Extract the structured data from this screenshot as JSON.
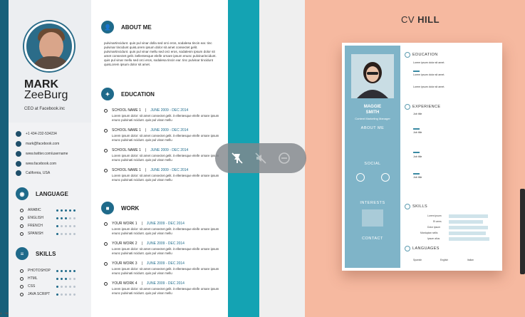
{
  "left_resume": {
    "first_name": "MARK",
    "last_name": "ZeeBurg",
    "role": "CEO at Facebook.inc",
    "contacts": [
      {
        "icon": "phone-icon",
        "text": "+1 434-232-534234"
      },
      {
        "icon": "email-icon",
        "text": "mark@facebook.com"
      },
      {
        "icon": "twitter-icon",
        "text": "www.twitter.com/username"
      },
      {
        "icon": "facebook-icon",
        "text": "www.facebook.com"
      },
      {
        "icon": "location-icon",
        "text": "California, USA"
      }
    ],
    "language_title": "LANGUAGE",
    "languages": [
      {
        "name": "ARABIC",
        "level": 5
      },
      {
        "name": "ENGLISH",
        "level": 3
      },
      {
        "name": "FRENCH",
        "level": 1
      },
      {
        "name": "SPANISH",
        "level": 1
      }
    ],
    "skills_title": "SKILLS",
    "skills": [
      {
        "name": "PHOTOSHOP",
        "level": 5
      },
      {
        "name": "HTML",
        "level": 3
      },
      {
        "name": "CSS",
        "level": 1
      },
      {
        "name": "JAVA SCRIPT",
        "level": 1
      }
    ],
    "about_title": "ABOUT ME",
    "about_text": "pulvinartincidunt. quis pul vinar dolla sed orci eros, sodalesa tincin ear. tinc pulvinar tincidunt quisLorem ipsum dolor sit amet consectet gelit. pulvinartincidunt. quis pul vinar mellu sed orci eros, sodalesm ipsum dolor sit amet consectet gelit. itellentesque eleife ornare ipsum enunc pulvinarincidunt. quis pul vinar mellu sed orci eros, sodalesa tincin ear. tinc pulvinar tincidunt quisLorem ipsum dolor sit amet.",
    "education_title": "EDUCATION",
    "education": [
      {
        "school": "SCHOOL NAME 1",
        "dates": "JUNE 2009 - DEC 2014",
        "text": "Lorem ipsum dolor: sit amet consectet gelit. it ellentesque eleife ornare ipsum enunc pulvinati ncidunt. quis pul vinar mellu"
      },
      {
        "school": "SCHOOL NAME 1",
        "dates": "JUNE 2009 - DEC 2014",
        "text": "Lorem ipsum dolor: sit amet consectet gelit. it ellentesque eleife ornare ipsum enunc pulvinati ncidunt. quis pul vinar mellu"
      },
      {
        "school": "SCHOOL NAME 1",
        "dates": "JUNE 2009 - DEC 2014",
        "text": "Lorem ipsum dolor: sit amet consectet gelit. it ellentesque eleife ornare ipsum enunc pulvinati ncidunt. quis pul vinar mellu"
      },
      {
        "school": "SCHOOL NAME 1",
        "dates": "JUNE 2009 - DEC 2014",
        "text": "Lorem ipsum dolor: sit amet consectet gelit. it ellentesque eleife ornare ipsum enunc pulvinati ncidunt. quis pul vinar mellu"
      }
    ],
    "work_title": "WORK",
    "work": [
      {
        "title": "YOUR WORK 1",
        "dates": "JUNE 2009 - DEC 2014",
        "text": "Lorem ipsum dolor: sit amet consectet gelit. it ellentesque eleife ornare ipsum enunc pulvinati ncidunt. quis pul vinar mellu"
      },
      {
        "title": "YOUR WORK 2",
        "dates": "JUNE 2009 - DEC 2014",
        "text": "Lorem ipsum dolor: sit amet consectet gelit. it ellentesque eleife ornare ipsum enunc pulvinati ncidunt. quis pul vinar mellu"
      },
      {
        "title": "YOUR WORK 3",
        "dates": "JUNE 2009 - DEC 2014",
        "text": "Lorem ipsum dolor: sit amet consectet gelit. it ellentesque eleife ornare ipsum enunc pulvinati ncidunt. quis pul vinar mellu"
      },
      {
        "title": "YOUR WORK 4",
        "dates": "JUNE 2009 - DEC 2014",
        "text": "Lorem ipsum dolor: sit amet consectet gelit. it ellentesque eleife ornare ipsum enunc pulvinati ncidunt. quis pul vinar mellu"
      }
    ]
  },
  "right_resume": {
    "brand_light": "CV ",
    "brand_bold": "HILL",
    "name_first": "MAGGIE",
    "name_last": "SMITH",
    "subtitle": "Content Marketing Manager",
    "about_title": "ABOUT ME",
    "social_title": "SOCIAL",
    "interests_title": "INTERESTS",
    "contact_title": "CONTACT",
    "education_title": "EDUCATION",
    "experience_title": "EXPERIENCE",
    "skills_title": "SKILLS",
    "languages_title": "LANGUAGES",
    "education_items": [
      "Lorem ipsum dolor sit amet.",
      "Lorem ipsum dolor sit amet.",
      "Lorem ipsum dolor sit amet."
    ],
    "experience_items": [
      "Job title",
      "Job title",
      "Job title",
      "Job title"
    ],
    "skill_labels": [
      "Lorem ipsum",
      "Et arms",
      "Dolor ipsum",
      "Marduplan sellis",
      "Ipsum alius"
    ],
    "languages": [
      "Spanish",
      "English",
      "Italian"
    ]
  },
  "overlay_controls": {
    "icons": [
      "pin-off-icon",
      "mute-icon",
      "minus-circle-icon"
    ]
  },
  "colors": {
    "teal": "#14a3b3",
    "navy": "#1f6a8a",
    "peach": "#f6b9a0",
    "card_blue": "#7fb4c8"
  }
}
